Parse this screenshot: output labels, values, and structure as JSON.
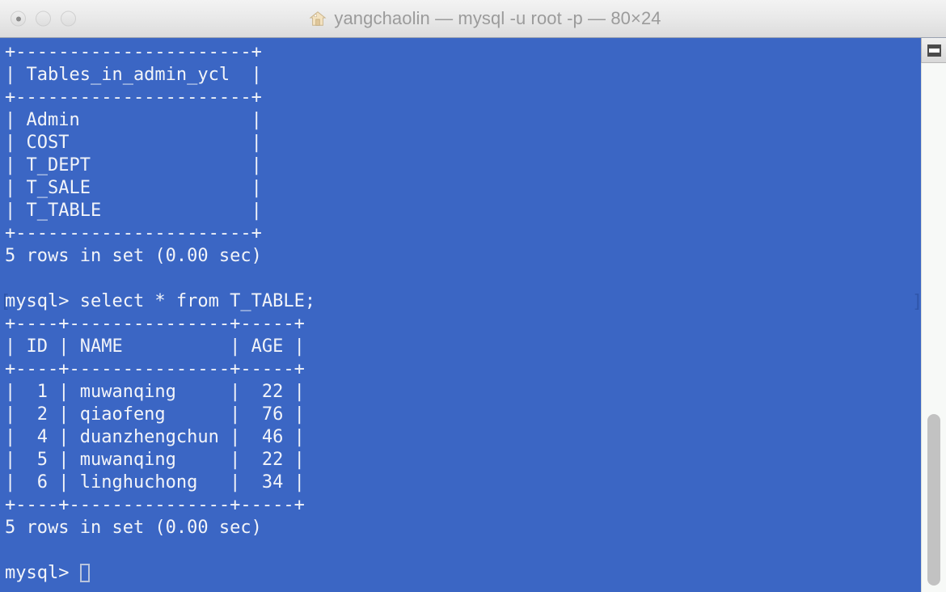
{
  "window": {
    "title": "yangchaolin — mysql -u root -p — 80×24",
    "home_icon": "home-icon",
    "traffic_lights": [
      "close",
      "minimize",
      "zoom"
    ],
    "colors": {
      "terminal_background": "#3b66c4",
      "terminal_text": "#f2f4f9",
      "titlebar_text": "#9b9b9b",
      "scrollbar_thumb": "#c2c2c2"
    }
  },
  "terminal": {
    "lines": [
      "+----------------------+",
      "| Tables_in_admin_ycl  |",
      "+----------------------+",
      "| Admin                |",
      "| COST                 |",
      "| T_DEPT               |",
      "| T_SALE               |",
      "| T_TABLE              |",
      "+----------------------+",
      "5 rows in set (0.00 sec)",
      "",
      "mysql> select * from T_TABLE;",
      "+----+---------------+-----+",
      "| ID | NAME          | AGE |",
      "+----+---------------+-----+",
      "|  1 | muwanqing     |  22 |",
      "|  2 | qiaofeng      |  76 |",
      "|  4 | duanzhengchun |  46 |",
      "|  5 | muwanqing     |  22 |",
      "|  6 | linghuchong   |  34 |",
      "+----+---------------+-----+",
      "5 rows in set (0.00 sec)",
      "",
      "mysql> "
    ],
    "prompt_line_index": 11,
    "cursor_line_index": 23,
    "mark_left": "[",
    "mark_right": "]",
    "tables_result": {
      "header": "Tables_in_admin_ycl",
      "rows": [
        "Admin",
        "COST",
        "T_DEPT",
        "T_SALE",
        "T_TABLE"
      ],
      "footer": "5 rows in set (0.00 sec)"
    },
    "query": "select * from T_TABLE;",
    "prompt": "mysql>",
    "select_result": {
      "columns": [
        "ID",
        "NAME",
        "AGE"
      ],
      "rows": [
        [
          "1",
          "muwanqing",
          "22"
        ],
        [
          "2",
          "qiaofeng",
          "76"
        ],
        [
          "4",
          "duanzhengchun",
          "46"
        ],
        [
          "5",
          "muwanqing",
          "22"
        ],
        [
          "6",
          "linghuchong",
          "34"
        ]
      ],
      "footer": "5 rows in set (0.00 sec)"
    }
  },
  "scrollbar": {
    "pane_icon": "split-pane-icon"
  }
}
